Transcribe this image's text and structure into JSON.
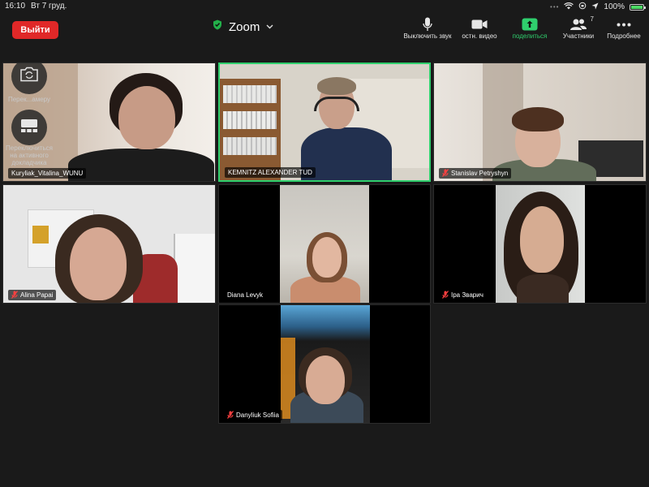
{
  "status_bar": {
    "time": "16:10",
    "date": "Вт 7 груд.",
    "battery": "100%"
  },
  "toolbar": {
    "leave_label": "Выйти",
    "title": "Zoom",
    "mute_label": "Выключить звук",
    "video_label": "остн. видео",
    "share_label": "поделиться",
    "participants_label": "Участники",
    "participants_count": "7",
    "more_label": "Подробнее"
  },
  "overlay": {
    "switch_camera_label": "Перек...амеру",
    "switch_active_speaker_label": "Переключиться на активного докладчика"
  },
  "participants": [
    {
      "name": "Kuryliak_Vitalina_WUNU",
      "muted": false
    },
    {
      "name": "KEMNITZ ALEXANDER TUD",
      "muted": false
    },
    {
      "name": "Stanislav Petryshyn",
      "muted": true
    },
    {
      "name": "Alina Papai",
      "muted": true
    },
    {
      "name": "Diana Levyk",
      "muted": false
    },
    {
      "name": "Іра Зварич",
      "muted": true
    },
    {
      "name": "Danyliuk Sofiia",
      "muted": true
    }
  ],
  "colors": {
    "leave": "#e02828",
    "active_speaker_border": "#2fcf6d",
    "share": "#2fcf6d",
    "muted_icon": "#ff4040"
  }
}
